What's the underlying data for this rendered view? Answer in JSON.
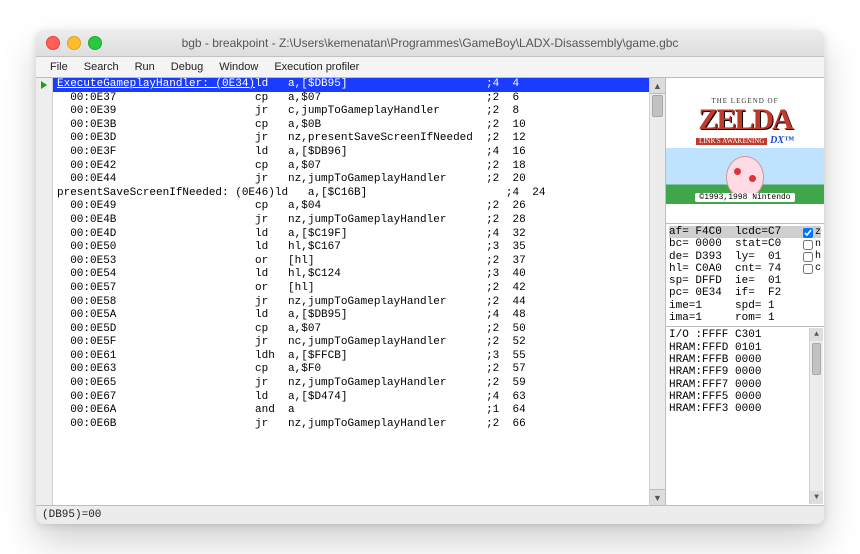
{
  "window": {
    "title": "bgb - breakpoint - Z:\\Users\\kemenatan\\Programmes\\GameBoy\\LADX-Disassembly\\game.gbc"
  },
  "menu": [
    "File",
    "Search",
    "Run",
    "Debug",
    "Window",
    "Execution profiler"
  ],
  "disasm": [
    {
      "sel": true,
      "lbl": "ExecuteGameplayHandler: (0E34)",
      "op": "ld",
      "args": "a,[$DB95]",
      "c": ";4  4"
    },
    {
      "addr": "00:0E37",
      "op": "cp",
      "args": "a,$07",
      "c": ";2  6"
    },
    {
      "addr": "00:0E39",
      "op": "jr",
      "args": "c,jumpToGameplayHandler",
      "c": ";2  8"
    },
    {
      "addr": "00:0E3B",
      "op": "cp",
      "args": "a,$0B",
      "c": ";2  10"
    },
    {
      "addr": "00:0E3D",
      "op": "jr",
      "args": "nz,presentSaveScreenIfNeeded",
      "c": ";2  12"
    },
    {
      "addr": "00:0E3F",
      "op": "ld",
      "args": "a,[$DB96]",
      "c": ";4  16"
    },
    {
      "addr": "00:0E42",
      "op": "cp",
      "args": "a,$07",
      "c": ";2  18"
    },
    {
      "addr": "00:0E44",
      "op": "jr",
      "args": "nz,jumpToGameplayHandler",
      "c": ";2  20"
    },
    {
      "lbl": "presentSaveScreenIfNeeded: (0E46)",
      "op": "ld",
      "args": "a,[$C16B]",
      "c": ";4  24"
    },
    {
      "addr": "00:0E49",
      "op": "cp",
      "args": "a,$04",
      "c": ";2  26"
    },
    {
      "addr": "00:0E4B",
      "op": "jr",
      "args": "nz,jumpToGameplayHandler",
      "c": ";2  28"
    },
    {
      "addr": "00:0E4D",
      "op": "ld",
      "args": "a,[$C19F]",
      "c": ";4  32"
    },
    {
      "addr": "00:0E50",
      "op": "ld",
      "args": "hl,$C167",
      "c": ";3  35"
    },
    {
      "addr": "00:0E53",
      "op": "or",
      "args": "[hl]",
      "c": ";2  37"
    },
    {
      "addr": "00:0E54",
      "op": "ld",
      "args": "hl,$C124",
      "c": ";3  40"
    },
    {
      "addr": "00:0E57",
      "op": "or",
      "args": "[hl]",
      "c": ";2  42"
    },
    {
      "addr": "00:0E58",
      "op": "jr",
      "args": "nz,jumpToGameplayHandler",
      "c": ";2  44"
    },
    {
      "addr": "00:0E5A",
      "op": "ld",
      "args": "a,[$DB95]",
      "c": ";4  48"
    },
    {
      "addr": "00:0E5D",
      "op": "cp",
      "args": "a,$07",
      "c": ";2  50"
    },
    {
      "addr": "00:0E5F",
      "op": "jr",
      "args": "nc,jumpToGameplayHandler",
      "c": ";2  52"
    },
    {
      "addr": "00:0E61",
      "op": "ldh",
      "args": "a,[$FFCB]",
      "c": ";3  55"
    },
    {
      "addr": "00:0E63",
      "op": "cp",
      "args": "a,$F0",
      "c": ";2  57"
    },
    {
      "addr": "00:0E65",
      "op": "jr",
      "args": "nz,jumpToGameplayHandler",
      "c": ";2  59"
    },
    {
      "addr": "00:0E67",
      "op": "ld",
      "args": "a,[$D474]",
      "c": ";4  63"
    },
    {
      "addr": "00:0E6A",
      "op": "and",
      "args": "a",
      "c": ";1  64"
    },
    {
      "addr": "00:0E6B",
      "op": "jr",
      "args": "nz,jumpToGameplayHandler",
      "c": ";2  66"
    }
  ],
  "preview": {
    "tagline": "THE LEGEND OF",
    "title": "ZELDA",
    "subtitle": "LINK'S AWAKENING",
    "dx": "DX™",
    "copyright": "©1993,1998 Nintendo"
  },
  "registers": [
    {
      "l": "af= F4C0",
      "r": "lcdc=C7",
      "hl": true
    },
    {
      "l": "bc= 0000",
      "r": "stat=C0"
    },
    {
      "l": "de= D393",
      "r": "ly=  01"
    },
    {
      "l": "hl= C0A0",
      "r": "cnt= 74"
    },
    {
      "l": "sp= DFFD",
      "r": "ie=  01"
    },
    {
      "l": "pc= 0E34",
      "r": "if=  F2"
    },
    {
      "l": "ime=1",
      "r": "spd= 1"
    },
    {
      "l": "ima=1",
      "r": "rom= 1"
    }
  ],
  "checks": [
    {
      "label": "z",
      "checked": true
    },
    {
      "label": "n",
      "checked": false
    },
    {
      "label": "h",
      "checked": false
    },
    {
      "label": "c",
      "checked": false
    }
  ],
  "memory": [
    "I/O :FFFF C301",
    "HRAM:FFFD 0101",
    "HRAM:FFFB 0000",
    "HRAM:FFF9 0000",
    "HRAM:FFF7 0000",
    "HRAM:FFF5 0000",
    "HRAM:FFF3 0000"
  ],
  "status": "(DB95)=00"
}
